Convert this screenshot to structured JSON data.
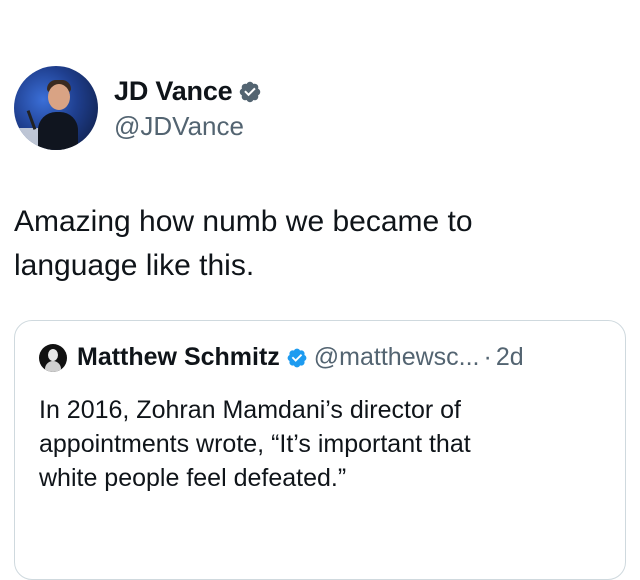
{
  "author": {
    "display_name": "JD Vance",
    "handle": "@JDVance",
    "verified_icon": "verified-badge-icon"
  },
  "tweet": {
    "text_line1": "Amazing how numb we became to",
    "text_line2": "language like this."
  },
  "quoted": {
    "display_name": "Matthew Schmitz",
    "handle": "@matthewsc...",
    "separator": "·",
    "time": "2d",
    "text_line1": "In 2016, Zohran Mamdani’s director of",
    "text_line2": "appointments wrote, “It’s important that",
    "text_line3": "white people feel defeated.”",
    "verified_icon": "verified-badge-icon"
  },
  "colors": {
    "verified_gray": "#536471",
    "verified_blue": "#1d9bf0",
    "secondary_text": "#536471",
    "border": "#cfd9de"
  }
}
